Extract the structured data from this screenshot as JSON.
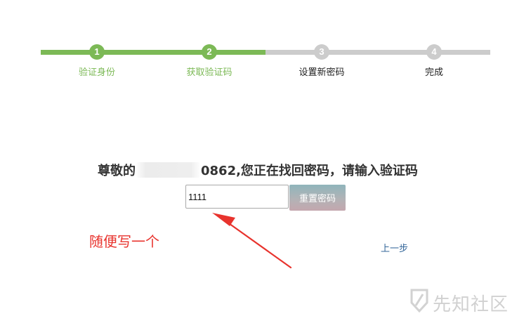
{
  "steps": [
    {
      "number": "1",
      "label": "验证身份"
    },
    {
      "number": "2",
      "label": "获取验证码"
    },
    {
      "number": "3",
      "label": "设置新密码"
    },
    {
      "number": "4",
      "label": "完成"
    }
  ],
  "progress": {
    "completed_steps": 2,
    "total_steps": 4
  },
  "message": {
    "prefix": "尊敬的",
    "suffix": "0862,您正在找回密码，请输入验证码"
  },
  "form": {
    "code_value": "1111",
    "reset_label": "重置密码"
  },
  "prev_link": "上一步",
  "annotation": "随便写一个",
  "watermark": "先知社区",
  "colors": {
    "done": "#7cb956",
    "todo": "#cccccc",
    "annotation": "#e8332d",
    "link": "#336699"
  }
}
